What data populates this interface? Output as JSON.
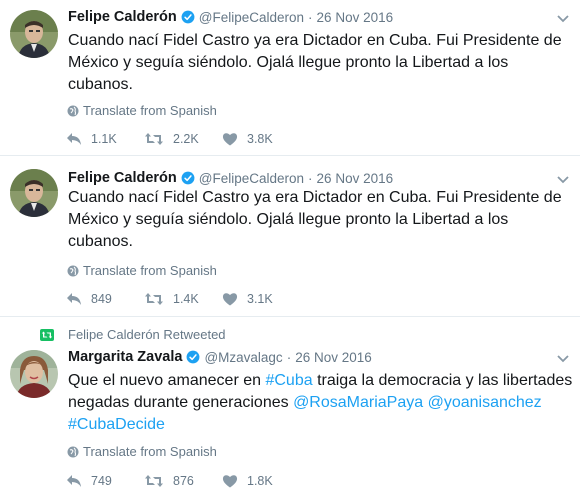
{
  "tweets": [
    {
      "name": "Felipe Calderón",
      "handle": "@FelipeCalderon",
      "separator": "·",
      "date": "26 Nov 2016",
      "text": "Cuando nací Fidel Castro ya era Dictador en Cuba. Fui Presidente de México y seguía siéndolo. Ojalá llegue pronto la Libertad a los cubanos.",
      "translate": "Translate from Spanish",
      "replies": "",
      "retweets": "1.1K",
      "likes": "2.2K",
      "heart": "3.8K"
    },
    {
      "name": "Felipe Calderón",
      "handle": "@FelipeCalderon",
      "separator": "·",
      "date": "26 Nov 2016",
      "text": "Cuando nací Fidel Castro ya era Dictador en Cuba. Fui Presidente de México y seguía siéndolo. Ojalá llegue pronto la Libertad a los cubanos.",
      "translate": "Translate from Spanish",
      "retweets": "849",
      "likes": "1.4K",
      "heart": "3.1K"
    },
    {
      "retweeted_by": "Felipe Calderón Retweeted",
      "name": "Margarita Zavala",
      "handle": "@Mzavalagc",
      "separator": "·",
      "date": "26 Nov 2016",
      "text_part1": "Que el nuevo amanecer en ",
      "hashtag1": "#Cuba",
      "text_part2": " traiga la democracia y las libertades negadas durante generaciones ",
      "mention1": "@RosaMariaPaya",
      "space": " ",
      "mention2": "@yoanisanchez",
      "hashtag2": "#CubaDecide",
      "translate": "Translate from Spanish",
      "retweets": "749",
      "likes": "876",
      "heart": "1.8K"
    }
  ],
  "colors": {
    "text": "#14171a",
    "muted": "#657786",
    "link": "#1da1f2",
    "verified": "#1da1f2",
    "retweet_green": "#17bf63",
    "divider": "#e6ecf0"
  }
}
